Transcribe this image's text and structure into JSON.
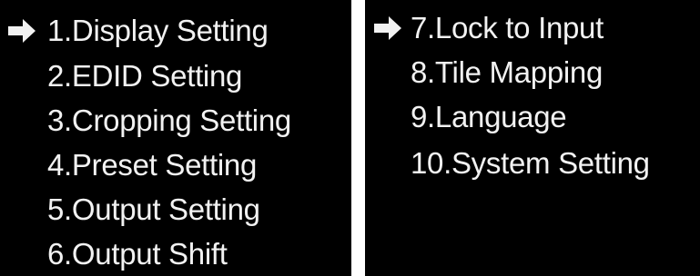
{
  "screens": {
    "left": {
      "selected_index": 0,
      "items": [
        {
          "label": "1.Display Setting"
        },
        {
          "label": "2.EDID Setting"
        },
        {
          "label": "3.Cropping Setting"
        },
        {
          "label": "4.Preset Setting"
        },
        {
          "label": "5.Output Setting"
        },
        {
          "label": "6.Output Shift"
        }
      ]
    },
    "right": {
      "selected_index": 0,
      "items": [
        {
          "label": "7.Lock to Input"
        },
        {
          "label": "8.Tile Mapping"
        },
        {
          "label": "9.Language"
        },
        {
          "label": "10.System Setting"
        }
      ]
    }
  },
  "colors": {
    "background": "#000000",
    "text": "#f2f2f2",
    "divider": "#ffffff"
  },
  "icons": {
    "selection_marker": "right-arrow-icon"
  }
}
